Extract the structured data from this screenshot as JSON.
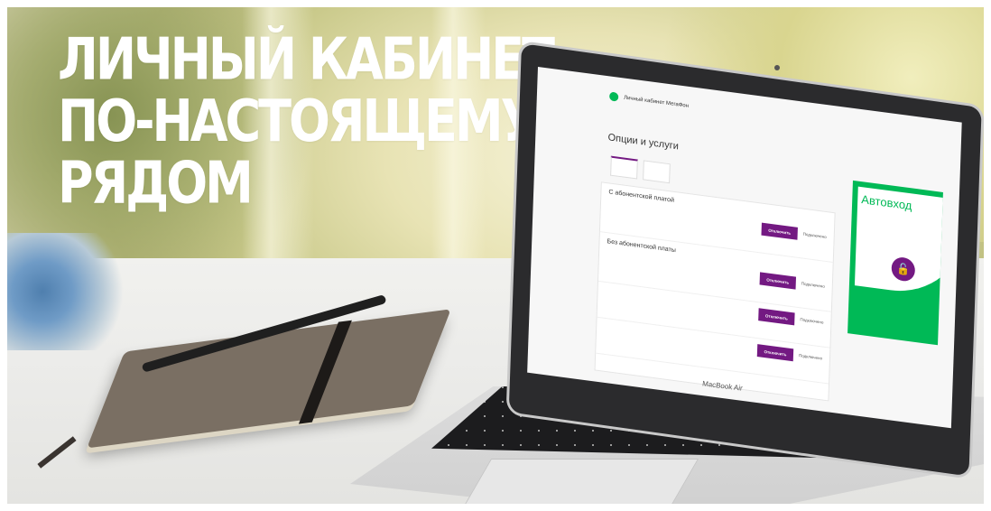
{
  "headline": {
    "line1": "ЛИЧНЫЙ КАБИНЕТ",
    "line2": "ПО-НАСТОЯЩЕМУ",
    "line3": "РЯДОМ"
  },
  "laptop_label": "MacBook Air",
  "screen": {
    "brand_accent": "#00b956",
    "button_color": "#731982",
    "header_title": "Личный кабинет МегаФон",
    "header_sub": "",
    "header_user": "",
    "breadcrumb": "",
    "page_title": "Опции и услуги",
    "tabs": [
      "",
      ""
    ],
    "section1": "С абонентской платой",
    "section2": "Без абонентской платы",
    "col_header": "",
    "rows": [
      {
        "link": "",
        "desc": "",
        "price": "",
        "btn": "Отключить",
        "btn2": "Подключено"
      },
      {
        "link": "",
        "desc": "",
        "price": "",
        "btn": "Отключить",
        "btn2": "Подключено"
      },
      {
        "link": "",
        "desc": "",
        "price": "",
        "btn": "Отключить",
        "btn2": "Подключено"
      },
      {
        "link": "",
        "desc": "",
        "price": "",
        "btn": "Отключить",
        "btn2": "Подключено"
      }
    ],
    "banner_title": "Автовход",
    "banner_sub": "",
    "banner_note": "",
    "lock_icon": "lock-icon"
  }
}
